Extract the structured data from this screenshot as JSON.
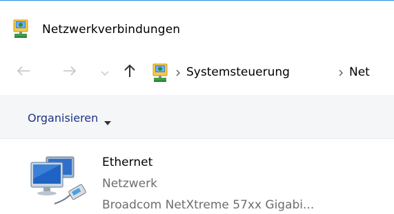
{
  "window": {
    "title": "Netzwerkverbindungen",
    "accent_color": "#1e8ce6"
  },
  "icons": {
    "title": "network-connections-icon",
    "address": "network-connections-icon",
    "back": "arrow-left-icon",
    "forward": "arrow-right-icon",
    "recent": "chevron-down-icon",
    "up": "arrow-up-icon",
    "separator": "chevron-right-icon",
    "organize_caret": "caret-down-icon",
    "ethernet": "ethernet-adapter-icon"
  },
  "address_bar": {
    "crumbs": [
      "Systemsteuerung",
      "Net"
    ]
  },
  "command_bar": {
    "organize_label": "Organisieren",
    "link_color": "#1e3287"
  },
  "connections": [
    {
      "name": "Ethernet",
      "status": "Netzwerk",
      "device": "Broadcom NetXtreme 57xx Gigabi..."
    }
  ]
}
